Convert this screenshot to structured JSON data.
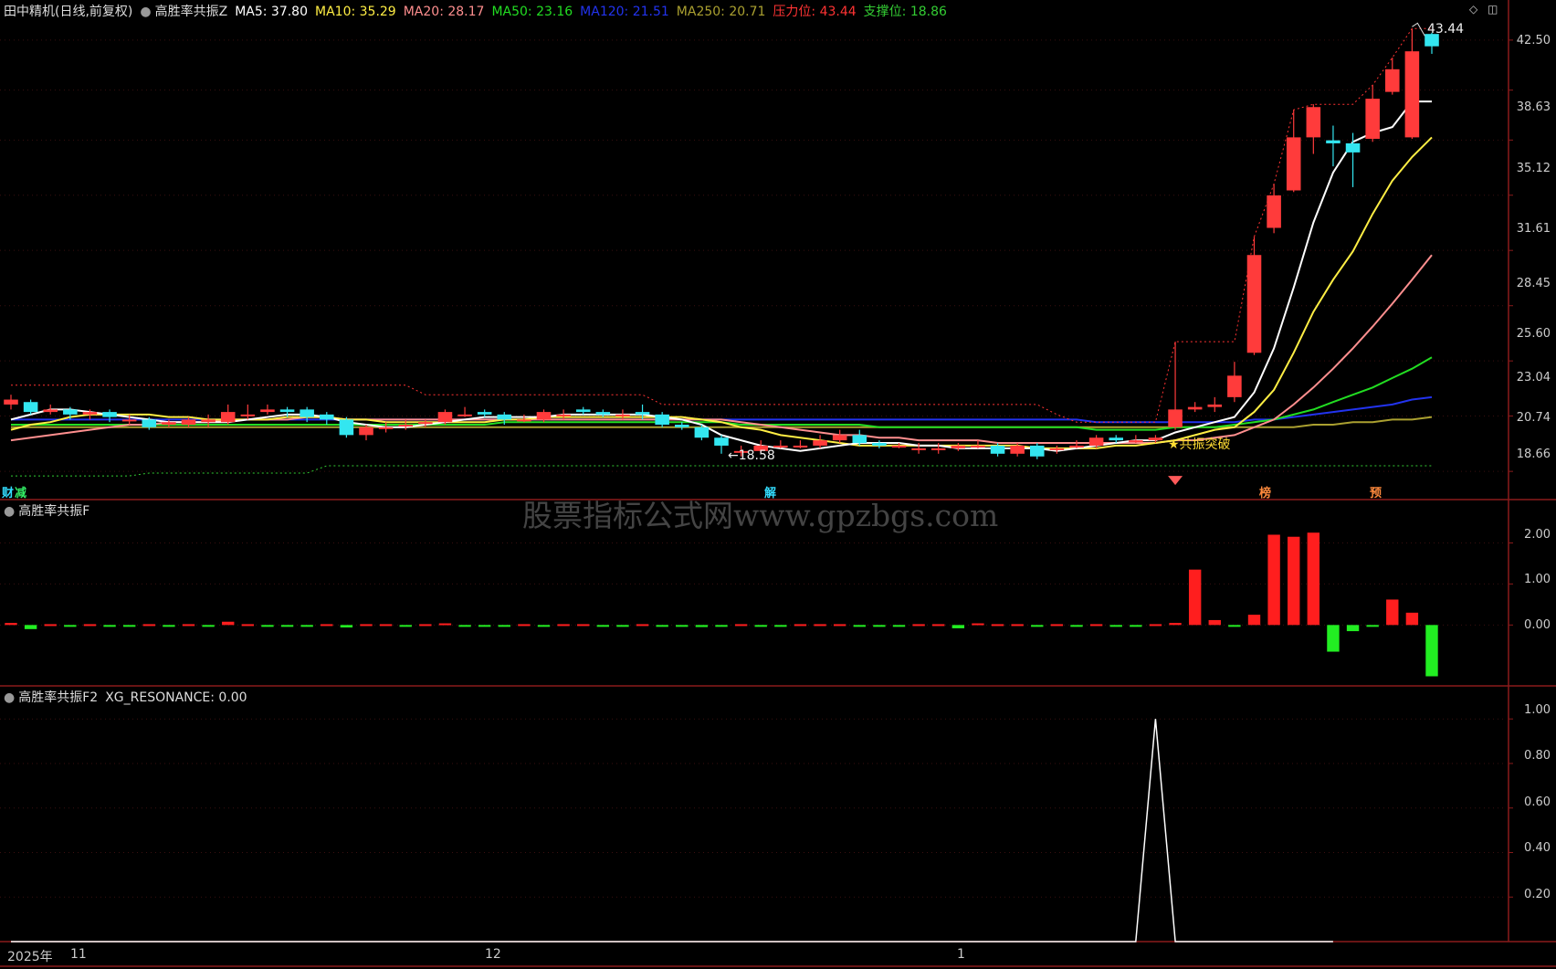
{
  "main_header": {
    "title": "田中精机(日线,前复权)",
    "indicator": "高胜率共振Z",
    "ma5": "MA5: 37.80",
    "ma10": "MA10: 35.29",
    "ma20": "MA20: 28.17",
    "ma50": "MA50: 23.16",
    "ma120": "MA120: 21.51",
    "ma250": "MA250: 20.71",
    "resistance": "压力位: 43.44",
    "support": "支撑位: 18.86"
  },
  "colors": {
    "ma5": "#ffffff",
    "ma10": "#ffee44",
    "ma20": "#ff8f8f",
    "ma50": "#22dd22",
    "ma120": "#2233ee",
    "ma250": "#aaa030",
    "resistance": "#ff3333",
    "support": "#33cc33",
    "up": "#ff3b3b",
    "down": "#33e6f0"
  },
  "price_axis": [
    "42.50",
    "38.63",
    "35.12",
    "31.61",
    "28.45",
    "25.60",
    "23.04",
    "20.74",
    "18.66"
  ],
  "annotations": {
    "high": "43.44",
    "low": "←18.58",
    "signal": "★共振突破",
    "tag_cai": "财",
    "tag_jian": "减",
    "tag_jie": "解",
    "tag_bang": "榜",
    "tag_yu": "预"
  },
  "watermark": "股票指标公式网www.gpzbgs.com",
  "panel2": {
    "title": "高胜率共振F",
    "axis": [
      "2.00",
      "1.00",
      "0.00"
    ]
  },
  "panel3": {
    "title": "高胜率共振F2",
    "value": "XG_RESONANCE: 0.00",
    "axis": [
      "1.00",
      "0.80",
      "0.60",
      "0.40",
      "0.20"
    ]
  },
  "dates": [
    "2025年",
    "11",
    "12",
    "1"
  ],
  "chart_data": [
    {
      "type": "candlestick",
      "title": "田中精机(日线,前复权)",
      "ylim": [
        17.9,
        44.0
      ],
      "scale": "log",
      "candles": [
        [
          21.2,
          21.4,
          21.6,
          21.0
        ],
        [
          21.3,
          20.9,
          21.4,
          20.8
        ],
        [
          20.9,
          21.0,
          21.2,
          20.8
        ],
        [
          21.0,
          20.8,
          21.1,
          20.6
        ],
        [
          20.8,
          20.9,
          21.0,
          20.6
        ],
        [
          20.9,
          20.7,
          21.0,
          20.5
        ],
        [
          20.6,
          20.6,
          20.8,
          20.4
        ],
        [
          20.6,
          20.3,
          20.7,
          20.2
        ],
        [
          20.4,
          20.5,
          20.6,
          20.3
        ],
        [
          20.4,
          20.6,
          20.7,
          20.3
        ],
        [
          20.5,
          20.6,
          20.8,
          20.3
        ],
        [
          20.5,
          20.9,
          21.2,
          20.4
        ],
        [
          20.8,
          20.8,
          21.2,
          20.6
        ],
        [
          20.9,
          21.0,
          21.2,
          20.8
        ],
        [
          21.0,
          20.9,
          21.1,
          20.7
        ],
        [
          21.0,
          20.7,
          21.1,
          20.5
        ],
        [
          20.8,
          20.6,
          20.9,
          20.4
        ],
        [
          20.6,
          20.0,
          20.7,
          19.9
        ],
        [
          20.0,
          20.3,
          20.4,
          19.8
        ],
        [
          20.3,
          20.3,
          20.5,
          20.1
        ],
        [
          20.4,
          20.4,
          20.6,
          20.2
        ],
        [
          20.5,
          20.5,
          20.6,
          20.3
        ],
        [
          20.5,
          20.9,
          21.0,
          20.4
        ],
        [
          20.8,
          20.8,
          21.1,
          20.7
        ],
        [
          20.9,
          20.8,
          21.0,
          20.7
        ],
        [
          20.8,
          20.6,
          20.9,
          20.4
        ],
        [
          20.6,
          20.6,
          20.8,
          20.5
        ],
        [
          20.6,
          20.9,
          21.0,
          20.5
        ],
        [
          20.8,
          20.8,
          21.0,
          20.6
        ],
        [
          21.0,
          20.9,
          21.1,
          20.8
        ],
        [
          20.9,
          20.8,
          21.0,
          20.7
        ],
        [
          20.8,
          20.8,
          21.0,
          20.6
        ],
        [
          20.9,
          20.8,
          21.2,
          20.6
        ],
        [
          20.8,
          20.4,
          20.9,
          20.3
        ],
        [
          20.4,
          20.3,
          20.5,
          20.2
        ],
        [
          20.3,
          19.9,
          20.4,
          19.8
        ],
        [
          19.9,
          19.6,
          20.0,
          19.3
        ],
        [
          19.4,
          19.4,
          19.6,
          19.2
        ],
        [
          19.4,
          19.6,
          19.8,
          19.3
        ],
        [
          19.6,
          19.6,
          19.8,
          19.5
        ],
        [
          19.6,
          19.6,
          19.8,
          19.5
        ],
        [
          19.6,
          19.8,
          20.0,
          19.5
        ],
        [
          19.8,
          20.0,
          20.2,
          19.7
        ],
        [
          20.0,
          19.7,
          20.2,
          19.6
        ],
        [
          19.7,
          19.6,
          19.8,
          19.5
        ],
        [
          19.6,
          19.6,
          19.7,
          19.5
        ],
        [
          19.5,
          19.5,
          19.7,
          19.3
        ],
        [
          19.5,
          19.5,
          19.7,
          19.3
        ],
        [
          19.5,
          19.6,
          19.7,
          19.4
        ],
        [
          19.6,
          19.6,
          19.8,
          19.5
        ],
        [
          19.6,
          19.3,
          19.7,
          19.2
        ],
        [
          19.3,
          19.6,
          19.7,
          19.2
        ],
        [
          19.6,
          19.2,
          19.7,
          19.1
        ],
        [
          19.5,
          19.5,
          19.6,
          19.3
        ],
        [
          19.6,
          19.6,
          19.8,
          19.5
        ],
        [
          19.6,
          19.9,
          20.0,
          19.5
        ],
        [
          19.9,
          19.8,
          20.0,
          19.7
        ],
        [
          19.8,
          19.8,
          20.0,
          19.7
        ],
        [
          19.8,
          19.9,
          20.0,
          19.7
        ],
        [
          20.3,
          21.0,
          23.9,
          20.2
        ],
        [
          21.0,
          21.1,
          21.3,
          20.9
        ],
        [
          21.1,
          21.2,
          21.5,
          20.9
        ],
        [
          21.5,
          22.4,
          23.0,
          21.3
        ],
        [
          23.4,
          28.2,
          29.2,
          23.3
        ],
        [
          29.7,
          31.6,
          32.3,
          29.4
        ],
        [
          31.9,
          35.3,
          37.2,
          31.8
        ],
        [
          35.3,
          37.4,
          37.6,
          34.2
        ],
        [
          35.1,
          34.9,
          36.1,
          33.4
        ],
        [
          34.9,
          34.3,
          35.6,
          32.1
        ],
        [
          35.2,
          38.0,
          39.0,
          35.0
        ],
        [
          38.5,
          40.2,
          41.1,
          38.3
        ],
        [
          35.3,
          41.6,
          43.44,
          35.2
        ],
        [
          43.0,
          42.0,
          43.1,
          41.4
        ]
      ],
      "ma": {
        "ma5": [
          20.6,
          20.8,
          21.0,
          21.0,
          20.9,
          20.8,
          20.7,
          20.6,
          20.5,
          20.5,
          20.5,
          20.5,
          20.6,
          20.7,
          20.8,
          20.8,
          20.7,
          20.5,
          20.4,
          20.3,
          20.3,
          20.4,
          20.5,
          20.6,
          20.7,
          20.7,
          20.7,
          20.7,
          20.8,
          20.8,
          20.8,
          20.8,
          20.8,
          20.7,
          20.6,
          20.4,
          20.0,
          19.8,
          19.6,
          19.5,
          19.4,
          19.5,
          19.6,
          19.7,
          19.7,
          19.7,
          19.6,
          19.6,
          19.5,
          19.5,
          19.5,
          19.5,
          19.5,
          19.4,
          19.5,
          19.6,
          19.7,
          19.8,
          19.8,
          20.1,
          20.3,
          20.5,
          20.7,
          21.7,
          23.6,
          26.5,
          30.0,
          33.0,
          35.0,
          35.6,
          36.0,
          37.8,
          37.8
        ],
        "ma10": [
          20.2,
          20.4,
          20.5,
          20.7,
          20.8,
          20.8,
          20.8,
          20.8,
          20.7,
          20.7,
          20.6,
          20.6,
          20.6,
          20.6,
          20.7,
          20.7,
          20.7,
          20.6,
          20.6,
          20.5,
          20.5,
          20.5,
          20.5,
          20.5,
          20.5,
          20.6,
          20.6,
          20.7,
          20.7,
          20.7,
          20.7,
          20.7,
          20.7,
          20.7,
          20.7,
          20.6,
          20.5,
          20.3,
          20.2,
          20.0,
          19.9,
          19.8,
          19.7,
          19.6,
          19.6,
          19.6,
          19.6,
          19.6,
          19.6,
          19.6,
          19.6,
          19.6,
          19.5,
          19.5,
          19.5,
          19.5,
          19.6,
          19.6,
          19.7,
          19.8,
          20.0,
          20.2,
          20.3,
          20.9,
          21.8,
          23.4,
          25.3,
          26.9,
          28.4,
          30.5,
          32.5,
          34.0,
          35.3
        ],
        "ma20": [
          19.8,
          19.9,
          20.0,
          20.1,
          20.2,
          20.3,
          20.4,
          20.4,
          20.5,
          20.5,
          20.5,
          20.6,
          20.6,
          20.6,
          20.6,
          20.7,
          20.7,
          20.6,
          20.6,
          20.6,
          20.6,
          20.6,
          20.6,
          20.6,
          20.6,
          20.6,
          20.6,
          20.6,
          20.6,
          20.6,
          20.6,
          20.6,
          20.6,
          20.6,
          20.6,
          20.6,
          20.6,
          20.5,
          20.4,
          20.3,
          20.2,
          20.1,
          20.0,
          20.0,
          19.9,
          19.9,
          19.8,
          19.8,
          19.8,
          19.8,
          19.7,
          19.7,
          19.7,
          19.7,
          19.7,
          19.7,
          19.7,
          19.7,
          19.7,
          19.8,
          19.8,
          19.9,
          20.0,
          20.3,
          20.6,
          21.2,
          21.9,
          22.7,
          23.6,
          24.6,
          25.7,
          26.9,
          28.2
        ],
        "ma50": [
          20.4,
          20.4,
          20.4,
          20.4,
          20.4,
          20.4,
          20.4,
          20.4,
          20.4,
          20.4,
          20.4,
          20.4,
          20.4,
          20.4,
          20.4,
          20.4,
          20.4,
          20.4,
          20.4,
          20.4,
          20.4,
          20.4,
          20.4,
          20.4,
          20.4,
          20.5,
          20.5,
          20.5,
          20.5,
          20.5,
          20.5,
          20.5,
          20.5,
          20.5,
          20.5,
          20.5,
          20.5,
          20.4,
          20.4,
          20.4,
          20.4,
          20.4,
          20.4,
          20.4,
          20.3,
          20.3,
          20.3,
          20.3,
          20.3,
          20.3,
          20.3,
          20.3,
          20.3,
          20.3,
          20.3,
          20.2,
          20.2,
          20.2,
          20.2,
          20.3,
          20.3,
          20.3,
          20.4,
          20.5,
          20.6,
          20.8,
          21.0,
          21.3,
          21.6,
          21.9,
          22.3,
          22.7,
          23.2
        ],
        "ma120": [
          20.6,
          20.6,
          20.6,
          20.6,
          20.6,
          20.6,
          20.6,
          20.6,
          20.6,
          20.6,
          20.6,
          20.6,
          20.6,
          20.6,
          20.6,
          20.6,
          20.6,
          20.6,
          20.6,
          20.6,
          20.6,
          20.6,
          20.6,
          20.6,
          20.6,
          20.6,
          20.6,
          20.6,
          20.6,
          20.6,
          20.6,
          20.6,
          20.6,
          20.6,
          20.6,
          20.6,
          20.6,
          20.6,
          20.6,
          20.6,
          20.6,
          20.6,
          20.6,
          20.6,
          20.6,
          20.6,
          20.6,
          20.6,
          20.6,
          20.6,
          20.6,
          20.6,
          20.6,
          20.6,
          20.6,
          20.5,
          20.5,
          20.5,
          20.5,
          20.5,
          20.5,
          20.5,
          20.5,
          20.6,
          20.6,
          20.7,
          20.8,
          20.9,
          21.0,
          21.1,
          21.2,
          21.4,
          21.5
        ],
        "ma250": [
          20.3,
          20.3,
          20.3,
          20.3,
          20.3,
          20.3,
          20.3,
          20.3,
          20.3,
          20.3,
          20.3,
          20.3,
          20.3,
          20.3,
          20.3,
          20.3,
          20.3,
          20.3,
          20.3,
          20.3,
          20.3,
          20.3,
          20.3,
          20.3,
          20.3,
          20.3,
          20.3,
          20.3,
          20.3,
          20.3,
          20.3,
          20.3,
          20.3,
          20.3,
          20.3,
          20.3,
          20.3,
          20.3,
          20.3,
          20.3,
          20.3,
          20.3,
          20.3,
          20.3,
          20.3,
          20.3,
          20.3,
          20.3,
          20.3,
          20.3,
          20.3,
          20.3,
          20.3,
          20.3,
          20.3,
          20.3,
          20.3,
          20.3,
          20.3,
          20.3,
          20.3,
          20.3,
          20.3,
          20.3,
          20.3,
          20.3,
          20.4,
          20.4,
          20.5,
          20.5,
          20.6,
          20.6,
          20.7
        ],
        "resistance": [
          22.0,
          22.0,
          22.0,
          22.0,
          22.0,
          22.0,
          22.0,
          22.0,
          22.0,
          22.0,
          22.0,
          22.0,
          22.0,
          22.0,
          22.0,
          22.0,
          22.0,
          22.0,
          22.0,
          22.0,
          22.0,
          21.6,
          21.6,
          21.6,
          21.6,
          21.6,
          21.6,
          21.6,
          21.6,
          21.6,
          21.6,
          21.6,
          21.6,
          21.2,
          21.2,
          21.2,
          21.2,
          21.2,
          21.2,
          21.2,
          21.2,
          21.2,
          21.2,
          21.2,
          21.2,
          21.2,
          21.2,
          21.2,
          21.2,
          21.2,
          21.2,
          21.2,
          21.2,
          20.8,
          20.5,
          20.5,
          20.5,
          20.5,
          20.5,
          23.9,
          23.9,
          23.9,
          23.9,
          29.2,
          32.3,
          37.2,
          37.6,
          37.6,
          37.6,
          39.0,
          41.1,
          43.44,
          43.44
        ],
        "support": [
          18.5,
          18.5,
          18.5,
          18.5,
          18.5,
          18.5,
          18.5,
          18.6,
          18.6,
          18.6,
          18.6,
          18.6,
          18.6,
          18.6,
          18.6,
          18.6,
          18.86,
          18.86,
          18.86,
          18.86,
          18.86,
          18.86,
          18.86,
          18.86,
          18.86,
          18.86,
          18.86,
          18.86,
          18.86,
          18.86,
          18.86,
          18.86,
          18.86,
          18.86,
          18.86,
          18.86,
          18.86,
          18.86,
          18.86,
          18.86,
          18.86,
          18.86,
          18.86,
          18.86,
          18.86,
          18.86,
          18.86,
          18.86,
          18.86,
          18.86,
          18.86,
          18.86,
          18.86,
          18.86,
          18.86,
          18.86,
          18.86,
          18.86,
          18.86,
          18.86,
          18.86,
          18.86,
          18.86,
          18.86,
          18.86,
          18.86,
          18.86,
          18.86,
          18.86,
          18.86,
          18.86,
          18.86,
          18.86
        ]
      }
    },
    {
      "type": "bar",
      "title": "高胜率共振F",
      "ylim": [
        -1.35,
        2.5
      ],
      "values": [
        0.05,
        -0.1,
        0.02,
        -0.02,
        0.02,
        -0.02,
        -0.03,
        0.02,
        -0.02,
        0.02,
        -0.02,
        0.08,
        0.02,
        -0.02,
        -0.04,
        -0.04,
        0.02,
        -0.06,
        0.02,
        0.02,
        -0.02,
        0.02,
        0.04,
        -0.02,
        -0.02,
        -0.02,
        0.02,
        -0.02,
        0.02,
        0.02,
        -0.02,
        -0.02,
        0.02,
        -0.03,
        -0.03,
        -0.05,
        -0.04,
        0.02,
        -0.02,
        -0.02,
        0.02,
        0.02,
        0.02,
        -0.02,
        -0.02,
        -0.02,
        0.02,
        0.02,
        -0.08,
        0.04,
        0.02,
        0.02,
        -0.02,
        0.02,
        -0.02,
        0.02,
        -0.02,
        -0.02,
        0.02,
        0.05,
        1.35,
        0.12,
        -0.04,
        0.25,
        2.2,
        2.15,
        2.25,
        -0.65,
        -0.15,
        -0.04,
        0.62,
        0.3,
        -1.25,
        0.02
      ]
    },
    {
      "type": "line",
      "title": "高胜率共振F2",
      "ylim": [
        0,
        1.05
      ],
      "values": [
        0,
        0,
        0,
        0,
        0,
        0,
        0,
        0,
        0,
        0,
        0,
        0,
        0,
        0,
        0,
        0,
        0,
        0,
        0,
        0,
        0,
        0,
        0,
        0,
        0,
        0,
        0,
        0,
        0,
        0,
        0,
        0,
        0,
        0,
        0,
        0,
        0,
        0,
        0,
        0,
        0,
        0,
        0,
        0,
        0,
        0,
        0,
        0,
        0,
        0,
        0,
        0,
        0,
        0,
        0,
        0,
        0,
        0,
        1,
        0,
        0,
        0,
        0,
        0,
        0,
        0,
        0,
        0
      ]
    }
  ]
}
